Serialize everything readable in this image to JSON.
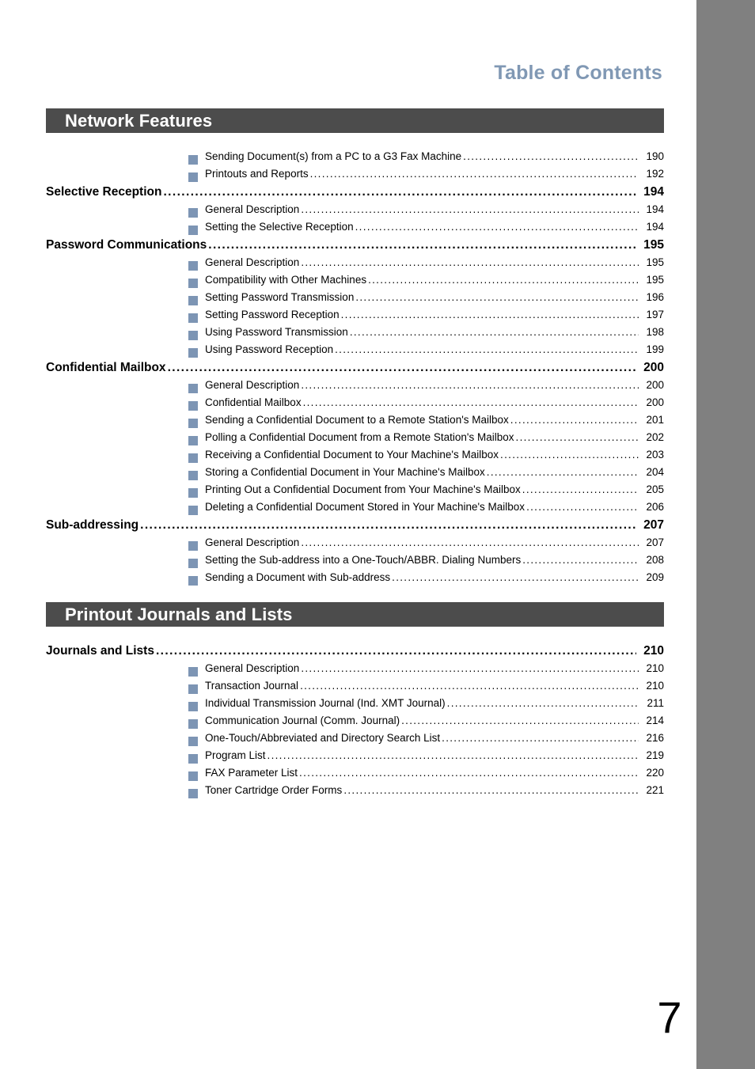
{
  "document": {
    "header_title": "Table of Contents",
    "folio": "7",
    "accent_color": "#8098b4",
    "bullet_color": "#7d95b4",
    "banner_color": "#4c4c4c",
    "edge_bar_color": "#808080"
  },
  "chapters": [
    {
      "title": "Network Features",
      "entries": [
        {
          "level": 2,
          "label": "Sending Document(s) from a PC to a G3 Fax Machine",
          "page": "190"
        },
        {
          "level": 2,
          "label": "Printouts and Reports",
          "page": "192"
        },
        {
          "level": 1,
          "label": "Selective Reception",
          "page": "194"
        },
        {
          "level": 2,
          "label": "General Description",
          "page": "194"
        },
        {
          "level": 2,
          "label": "Setting the Selective Reception",
          "page": "194"
        },
        {
          "level": 1,
          "label": "Password Communications",
          "page": "195"
        },
        {
          "level": 2,
          "label": "General Description",
          "page": "195"
        },
        {
          "level": 2,
          "label": "Compatibility with Other Machines",
          "page": "195"
        },
        {
          "level": 2,
          "label": "Setting Password Transmission",
          "page": "196"
        },
        {
          "level": 2,
          "label": "Setting Password Reception",
          "page": "197"
        },
        {
          "level": 2,
          "label": "Using Password Transmission",
          "page": "198"
        },
        {
          "level": 2,
          "label": "Using Password Reception",
          "page": "199"
        },
        {
          "level": 1,
          "label": "Confidential Mailbox",
          "page": "200"
        },
        {
          "level": 2,
          "label": "General Description",
          "page": "200"
        },
        {
          "level": 2,
          "label": "Confidential Mailbox",
          "page": "200"
        },
        {
          "level": 2,
          "label": "Sending a Confidential Document to a Remote Station's Mailbox",
          "page": "201"
        },
        {
          "level": 2,
          "label": "Polling a Confidential Document from a Remote Station's Mailbox",
          "page": "202"
        },
        {
          "level": 2,
          "label": "Receiving a Confidential Document to Your Machine's Mailbox",
          "page": "203"
        },
        {
          "level": 2,
          "label": "Storing a Confidential Document in Your Machine's Mailbox",
          "page": "204"
        },
        {
          "level": 2,
          "label": "Printing Out a Confidential Document from Your Machine's Mailbox",
          "page": "205"
        },
        {
          "level": 2,
          "label": "Deleting a Confidential Document Stored in Your Machine's Mailbox",
          "page": "206"
        },
        {
          "level": 1,
          "label": "Sub-addressing",
          "page": "207"
        },
        {
          "level": 2,
          "label": "General Description",
          "page": "207"
        },
        {
          "level": 2,
          "label": "Setting the Sub-address into a One-Touch/ABBR. Dialing Numbers",
          "page": "208"
        },
        {
          "level": 2,
          "label": "Sending a Document with Sub-address",
          "page": "209"
        }
      ]
    },
    {
      "title": "Printout Journals and Lists",
      "entries": [
        {
          "level": 1,
          "label": "Journals and Lists",
          "page": "210"
        },
        {
          "level": 2,
          "label": "General Description",
          "page": "210"
        },
        {
          "level": 2,
          "label": "Transaction Journal",
          "page": "210"
        },
        {
          "level": 2,
          "label": "Individual Transmission Journal (Ind. XMT Journal)",
          "page": "211"
        },
        {
          "level": 2,
          "label": "Communication Journal (Comm. Journal)",
          "page": "214"
        },
        {
          "level": 2,
          "label": "One-Touch/Abbreviated and Directory Search List",
          "page": "216"
        },
        {
          "level": 2,
          "label": "Program List",
          "page": "219"
        },
        {
          "level": 2,
          "label": "FAX Parameter List",
          "page": "220"
        },
        {
          "level": 2,
          "label": "Toner Cartridge Order Forms",
          "page": "221"
        }
      ]
    }
  ]
}
